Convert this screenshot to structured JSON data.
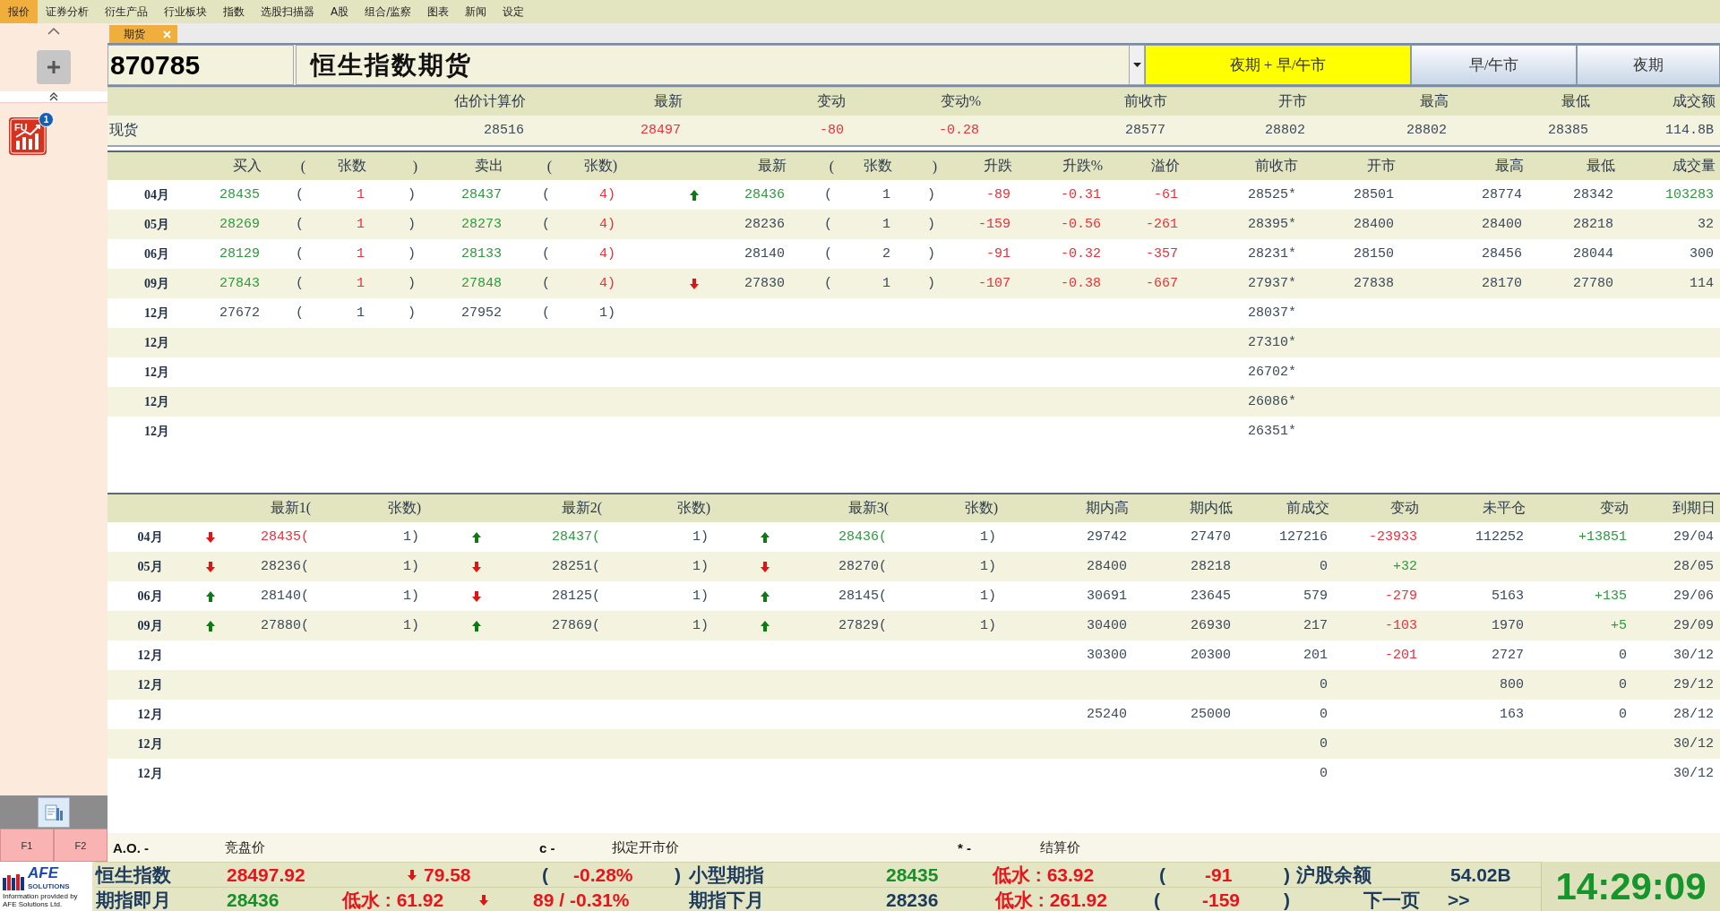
{
  "menu": [
    {
      "label": "报价",
      "selected": true
    },
    {
      "label": "证券分析",
      "selected": false
    },
    {
      "label": "衍生产品",
      "selected": false
    },
    {
      "label": "行业板块",
      "selected": false
    },
    {
      "label": "指数",
      "selected": false
    },
    {
      "label": "选股扫描器",
      "selected": false
    },
    {
      "label": "A股",
      "selected": false
    },
    {
      "label": "组合/监察",
      "selected": false
    },
    {
      "label": "图表",
      "selected": false
    },
    {
      "label": "新闻",
      "selected": false
    },
    {
      "label": "设定",
      "selected": false
    }
  ],
  "sidebar": {
    "apps": [
      {
        "label": "FU",
        "badge": "1"
      }
    ],
    "function_keys": [
      "F1",
      "F2"
    ]
  },
  "tabs": [
    {
      "label": "期货",
      "selected": true
    }
  ],
  "quote": {
    "code": "870785",
    "name": "恒生指数期货",
    "sessions": [
      {
        "label": "夜期 + 早/午市",
        "selected": true
      },
      {
        "label": "早/午市",
        "selected": false
      },
      {
        "label": "夜期",
        "selected": false
      }
    ]
  },
  "spot": {
    "columns": [
      "",
      "估价计算价",
      "最新",
      "变动",
      "变动%",
      "前收市",
      "开市",
      "最高",
      "最低",
      "成交额"
    ],
    "rows": [
      {
        "cells": [
          {
            "text": "现货"
          },
          {
            "text": "28516"
          },
          {
            "text": "28497",
            "color": "#e8303a"
          },
          {
            "text": "-80",
            "color": "#e8303a"
          },
          {
            "text": "-0.28",
            "color": "#e8303a"
          },
          {
            "text": "28577"
          },
          {
            "text": "28802"
          },
          {
            "text": "28802"
          },
          {
            "text": "28385"
          },
          {
            "text": "114.8B"
          }
        ]
      }
    ]
  },
  "order_book": {
    "columns": [
      "",
      "买入",
      "(",
      "张数",
      ")",
      "卖出",
      "(",
      "张数)",
      "",
      "最新",
      "(",
      "张数",
      ")",
      "升跌",
      "升跌%",
      "溢价",
      "前收市",
      "开市",
      "最高",
      "最低",
      "成交量"
    ],
    "rows": [
      {
        "cells": [
          {
            "text": "04月"
          },
          {
            "text": "28435",
            "color": "#2e9a3e"
          },
          {
            "text": "("
          },
          {
            "text": "1",
            "color": "#e8303a"
          },
          {
            "text": ")"
          },
          {
            "text": "28437",
            "color": "#2e9a3e"
          },
          {
            "text": "("
          },
          {
            "text": "4)",
            "color": "#e8303a"
          },
          {
            "kind": "arrow",
            "rising": true
          },
          {
            "text": "28436",
            "color": "#2e9a3e"
          },
          {
            "text": "("
          },
          {
            "text": "1"
          },
          {
            "text": ")"
          },
          {
            "text": "-89",
            "color": "#e8303a"
          },
          {
            "text": "-0.31",
            "color": "#e8303a"
          },
          {
            "text": "-61",
            "color": "#e8303a"
          },
          {
            "text": "28525*"
          },
          {
            "text": "28501"
          },
          {
            "text": "28774"
          },
          {
            "text": "28342"
          },
          {
            "text": "103283",
            "color": "#2e9a3e"
          }
        ]
      },
      {
        "cells": [
          {
            "text": "05月"
          },
          {
            "text": "28269",
            "color": "#2e9a3e"
          },
          {
            "text": "("
          },
          {
            "text": "1",
            "color": "#e8303a"
          },
          {
            "text": ")"
          },
          {
            "text": "28273",
            "color": "#2e9a3e"
          },
          {
            "text": "("
          },
          {
            "text": "4)",
            "color": "#e8303a"
          },
          null,
          {
            "text": "28236"
          },
          {
            "text": "("
          },
          {
            "text": "1"
          },
          {
            "text": ")"
          },
          {
            "text": "-159",
            "color": "#e8303a"
          },
          {
            "text": "-0.56",
            "color": "#e8303a"
          },
          {
            "text": "-261",
            "color": "#e8303a"
          },
          {
            "text": "28395*"
          },
          {
            "text": "28400"
          },
          {
            "text": "28400"
          },
          {
            "text": "28218"
          },
          {
            "text": "32"
          }
        ]
      },
      {
        "cells": [
          {
            "text": "06月"
          },
          {
            "text": "28129",
            "color": "#2e9a3e"
          },
          {
            "text": "("
          },
          {
            "text": "1",
            "color": "#e8303a"
          },
          {
            "text": ")"
          },
          {
            "text": "28133",
            "color": "#2e9a3e"
          },
          {
            "text": "("
          },
          {
            "text": "4)",
            "color": "#e8303a"
          },
          null,
          {
            "text": "28140"
          },
          {
            "text": "("
          },
          {
            "text": "2"
          },
          {
            "text": ")"
          },
          {
            "text": "-91",
            "color": "#e8303a"
          },
          {
            "text": "-0.32",
            "color": "#e8303a"
          },
          {
            "text": "-357",
            "color": "#e8303a"
          },
          {
            "text": "28231*"
          },
          {
            "text": "28150"
          },
          {
            "text": "28456"
          },
          {
            "text": "28044"
          },
          {
            "text": "300"
          }
        ]
      },
      {
        "cells": [
          {
            "text": "09月"
          },
          {
            "text": "27843",
            "color": "#2e9a3e"
          },
          {
            "text": "("
          },
          {
            "text": "1",
            "color": "#e8303a"
          },
          {
            "text": ")"
          },
          {
            "text": "27848",
            "color": "#2e9a3e"
          },
          {
            "text": "("
          },
          {
            "text": "4)",
            "color": "#e8303a"
          },
          {
            "kind": "arrow",
            "rising": false
          },
          {
            "text": "27830"
          },
          {
            "text": "("
          },
          {
            "text": "1"
          },
          {
            "text": ")"
          },
          {
            "text": "-107",
            "color": "#e8303a"
          },
          {
            "text": "-0.38",
            "color": "#e8303a"
          },
          {
            "text": "-667",
            "color": "#e8303a"
          },
          {
            "text": "27937*"
          },
          {
            "text": "27838"
          },
          {
            "text": "28170"
          },
          {
            "text": "27780"
          },
          {
            "text": "114"
          }
        ]
      },
      {
        "cells": [
          {
            "text": "12月"
          },
          {
            "text": "27672"
          },
          {
            "text": "("
          },
          {
            "text": "1"
          },
          {
            "text": ")"
          },
          {
            "text": "27952"
          },
          {
            "text": "("
          },
          {
            "text": "1)"
          },
          null,
          null,
          null,
          null,
          null,
          null,
          null,
          null,
          {
            "text": "28037*"
          },
          null,
          null,
          null,
          null
        ]
      },
      {
        "cells": [
          {
            "text": "12月"
          },
          null,
          null,
          null,
          null,
          null,
          null,
          null,
          null,
          null,
          null,
          null,
          null,
          null,
          null,
          null,
          {
            "text": "27310*"
          },
          null,
          null,
          null,
          null
        ]
      },
      {
        "cells": [
          {
            "text": "12月"
          },
          null,
          null,
          null,
          null,
          null,
          null,
          null,
          null,
          null,
          null,
          null,
          null,
          null,
          null,
          null,
          {
            "text": "26702*"
          },
          null,
          null,
          null,
          null
        ]
      },
      {
        "cells": [
          {
            "text": "12月"
          },
          null,
          null,
          null,
          null,
          null,
          null,
          null,
          null,
          null,
          null,
          null,
          null,
          null,
          null,
          null,
          {
            "text": "26086*"
          },
          null,
          null,
          null,
          null
        ]
      },
      {
        "cells": [
          {
            "text": "12月"
          },
          null,
          null,
          null,
          null,
          null,
          null,
          null,
          null,
          null,
          null,
          null,
          null,
          null,
          null,
          null,
          {
            "text": "26351*"
          },
          null,
          null,
          null,
          null
        ]
      }
    ]
  },
  "trade_table": {
    "columns": [
      "",
      "",
      "最新1(",
      "张数)",
      "",
      "最新2(",
      "张数)",
      "",
      "最新3(",
      "张数)",
      "期内高",
      "期内低",
      "前成交",
      "变动",
      "未平仓",
      "变动",
      "到期日"
    ],
    "rows": [
      {
        "cells": [
          {
            "text": "04月"
          },
          {
            "kind": "arrow",
            "rising": false
          },
          {
            "text": "28435(",
            "color": "#e8303a"
          },
          {
            "text": "1)"
          },
          {
            "kind": "arrow",
            "rising": true
          },
          {
            "text": "28437(",
            "color": "#2e9a3e"
          },
          {
            "text": "1)"
          },
          {
            "kind": "arrow",
            "rising": true
          },
          {
            "text": "28436(",
            "color": "#2e9a3e"
          },
          {
            "text": "1)"
          },
          {
            "text": "29742"
          },
          {
            "text": "27470"
          },
          {
            "text": "127216"
          },
          {
            "text": "-23933",
            "color": "#e8303a"
          },
          {
            "text": "112252"
          },
          {
            "text": "+13851",
            "color": "#2e9a3e"
          },
          {
            "text": "29/04"
          }
        ]
      },
      {
        "cells": [
          {
            "text": "05月"
          },
          {
            "kind": "arrow",
            "rising": false
          },
          {
            "text": "28236("
          },
          {
            "text": "1)"
          },
          {
            "kind": "arrow",
            "rising": false
          },
          {
            "text": "28251("
          },
          {
            "text": "1)"
          },
          {
            "kind": "arrow",
            "rising": false
          },
          {
            "text": "28270("
          },
          {
            "text": "1)"
          },
          {
            "text": "28400"
          },
          {
            "text": "28218"
          },
          {
            "text": "0"
          },
          {
            "text": "+32",
            "color": "#2e9a3e"
          },
          null,
          null,
          {
            "text": "28/05"
          }
        ]
      },
      {
        "cells": [
          {
            "text": "06月"
          },
          {
            "kind": "arrow",
            "rising": true
          },
          {
            "text": "28140("
          },
          {
            "text": "1)"
          },
          {
            "kind": "arrow",
            "rising": false
          },
          {
            "text": "28125("
          },
          {
            "text": "1)"
          },
          {
            "kind": "arrow",
            "rising": true
          },
          {
            "text": "28145("
          },
          {
            "text": "1)"
          },
          {
            "text": "30691"
          },
          {
            "text": "23645"
          },
          {
            "text": "579"
          },
          {
            "text": "-279",
            "color": "#e8303a"
          },
          {
            "text": "5163"
          },
          {
            "text": "+135",
            "color": "#2e9a3e"
          },
          {
            "text": "29/06"
          }
        ]
      },
      {
        "cells": [
          {
            "text": "09月"
          },
          {
            "kind": "arrow",
            "rising": true
          },
          {
            "text": "27880("
          },
          {
            "text": "1)"
          },
          {
            "kind": "arrow",
            "rising": true
          },
          {
            "text": "27869("
          },
          {
            "text": "1)"
          },
          {
            "kind": "arrow",
            "rising": true
          },
          {
            "text": "27829("
          },
          {
            "text": "1)"
          },
          {
            "text": "30400"
          },
          {
            "text": "26930"
          },
          {
            "text": "217"
          },
          {
            "text": "-103",
            "color": "#e8303a"
          },
          {
            "text": "1970"
          },
          {
            "text": "+5",
            "color": "#2e9a3e"
          },
          {
            "text": "29/09"
          }
        ]
      },
      {
        "cells": [
          {
            "text": "12月"
          },
          null,
          null,
          null,
          null,
          null,
          null,
          null,
          null,
          null,
          {
            "text": "30300"
          },
          {
            "text": "20300"
          },
          {
            "text": "201"
          },
          {
            "text": "-201",
            "color": "#e8303a"
          },
          {
            "text": "2727"
          },
          {
            "text": "0"
          },
          {
            "text": "30/12"
          }
        ]
      },
      {
        "cells": [
          {
            "text": "12月"
          },
          null,
          null,
          null,
          null,
          null,
          null,
          null,
          null,
          null,
          null,
          null,
          {
            "text": "0"
          },
          null,
          {
            "text": "800"
          },
          {
            "text": "0"
          },
          {
            "text": "29/12"
          }
        ]
      },
      {
        "cells": [
          {
            "text": "12月"
          },
          null,
          null,
          null,
          null,
          null,
          null,
          null,
          null,
          null,
          {
            "text": "25240"
          },
          {
            "text": "25000"
          },
          {
            "text": "0"
          },
          null,
          {
            "text": "163"
          },
          {
            "text": "0"
          },
          {
            "text": "28/12"
          }
        ]
      },
      {
        "cells": [
          {
            "text": "12月"
          },
          null,
          null,
          null,
          null,
          null,
          null,
          null,
          null,
          null,
          null,
          null,
          {
            "text": "0"
          },
          null,
          null,
          null,
          {
            "text": "30/12"
          }
        ]
      },
      {
        "cells": [
          {
            "text": "12月"
          },
          null,
          null,
          null,
          null,
          null,
          null,
          null,
          null,
          null,
          null,
          null,
          {
            "text": "0"
          },
          null,
          null,
          null,
          {
            "text": "30/12"
          }
        ]
      }
    ]
  },
  "legend": [
    {
      "symbol": "A.O. -",
      "label": "竞盘价"
    },
    {
      "symbol": "c -",
      "label": "拟定开市价"
    },
    {
      "symbol": "* -",
      "label": "结算价"
    }
  ],
  "ticker": {
    "lines": [
      [
        {
          "text": "恒生指数",
          "color": "#1c3a5e"
        },
        {
          "text": "28497.92",
          "color": "#e8141c"
        },
        {
          "text": "79.58",
          "color": "#e8141c",
          "kind": "arrow",
          "rising": false
        },
        {
          "text": "(",
          "color": "#1c3a5e"
        },
        {
          "text": "-0.28%",
          "color": "#e8141c"
        },
        {
          "text": ")",
          "color": "#1c3a5e"
        },
        {
          "text": "小型期指",
          "color": "#1c3a5e"
        },
        {
          "text": "28435",
          "color": "#17902a"
        },
        {
          "text": "低水 : 63.92",
          "color": "#e8141c"
        },
        {
          "text": "(",
          "color": "#1c3a5e"
        },
        {
          "text": "-91",
          "color": "#e8141c"
        },
        {
          "text": ")",
          "color": "#1c3a5e"
        },
        {
          "text": "沪股余额",
          "color": "#1c3a5e"
        },
        {
          "text": "54.02B",
          "color": "#1c3a5e"
        }
      ],
      [
        {
          "text": "期指即月",
          "color": "#1c3a5e"
        },
        {
          "text": "28436",
          "color": "#17902a"
        },
        {
          "text": "低水 : 61.92",
          "color": "#e8141c"
        },
        {
          "text": "89 /",
          "color": "#e8141c",
          "kind": "arrow",
          "rising": false
        },
        {
          "text": "-0.31%",
          "color": "#e8141c"
        },
        {
          "text": "期指下月",
          "color": "#1c3a5e"
        },
        {
          "text": "28236",
          "color": "#1c3a5e"
        },
        {
          "text": "低水 : 261.92",
          "color": "#e8141c"
        },
        {
          "text": "(",
          "color": "#1c3a5e"
        },
        {
          "text": "-159",
          "color": "#e8141c"
        },
        {
          "text": ")",
          "color": "#1c3a5e"
        },
        {
          "text": "下一页",
          "color": "#1c3a5e"
        },
        {
          "text": ">>",
          "color": "#1c3a5e"
        }
      ]
    ],
    "clock": "14:29:09"
  },
  "footer": {
    "logo": "AFE",
    "logo_sub": "SOLUTIONS",
    "credit": "Information provided by AFE Solutions Ltd."
  }
}
